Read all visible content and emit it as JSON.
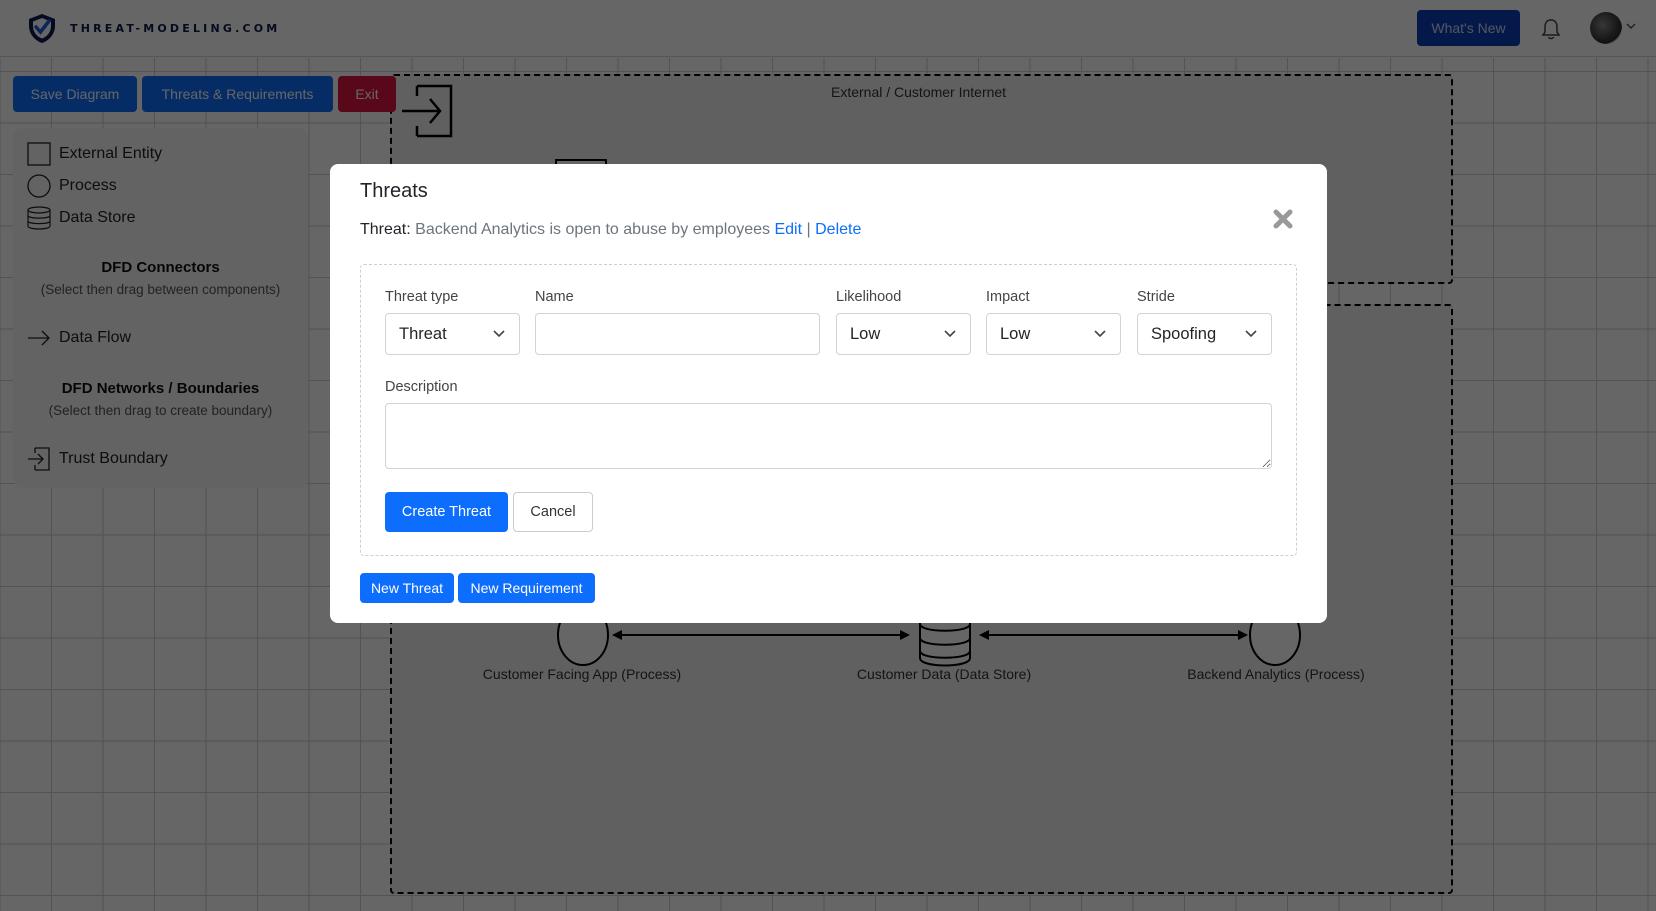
{
  "header": {
    "brand": "THREAT-MODELING.COM",
    "whats_new_label": "What's New",
    "icons": {
      "logo": "shield-check-icon",
      "notifications": "bell-icon",
      "avatar": "user-avatar",
      "menu": "chevron-down-icon"
    }
  },
  "toolbar": {
    "save_label": "Save Diagram",
    "threats_label": "Threats & Requirements",
    "exit_label": "Exit"
  },
  "palette": {
    "components": [
      {
        "label": "External Entity",
        "icon": "square-icon"
      },
      {
        "label": "Process",
        "icon": "circle-icon"
      },
      {
        "label": "Data Store",
        "icon": "database-icon"
      }
    ],
    "connectors_heading": "DFD Connectors",
    "connectors_hint": "(Select then drag between components)",
    "connectors": [
      {
        "label": "Data Flow",
        "icon": "arrow-right-icon"
      }
    ],
    "boundaries_heading": "DFD Networks / Boundaries",
    "boundaries_hint": "(Select then drag to create boundary)",
    "boundaries": [
      {
        "label": "Trust Boundary",
        "icon": "boundary-enter-icon"
      }
    ]
  },
  "diagram": {
    "boundaries": [
      {
        "label": "External / Customer Internet"
      }
    ],
    "nodes": [
      {
        "label": "Customer Facing App (Process)",
        "type": "process"
      },
      {
        "label": "Customer Data (Data Store)",
        "type": "datastore"
      },
      {
        "label": "Backend Analytics (Process)",
        "type": "process"
      }
    ],
    "flows": [
      {
        "from": "Customer Facing App (Process)",
        "to": "Customer Data (Data Store)",
        "bidirectional": true
      },
      {
        "from": "Customer Data (Data Store)",
        "to": "Backend Analytics (Process)",
        "bidirectional": true
      }
    ]
  },
  "modal": {
    "title": "Threats",
    "threat_prefix": "Threat:",
    "threat_text": "Backend Analytics is open to abuse by employees",
    "edit_label": "Edit",
    "separator": "|",
    "delete_label": "Delete",
    "form": {
      "threat_type": {
        "label": "Threat type",
        "value": "Threat"
      },
      "name": {
        "label": "Name",
        "value": "",
        "placeholder": ""
      },
      "likelihood": {
        "label": "Likelihood",
        "value": "Low"
      },
      "impact": {
        "label": "Impact",
        "value": "Low"
      },
      "stride": {
        "label": "Stride",
        "value": "Spoofing"
      },
      "description": {
        "label": "Description",
        "value": "",
        "placeholder": ""
      },
      "create_label": "Create Threat",
      "cancel_label": "Cancel"
    },
    "new_threat_label": "New Threat",
    "new_requirement_label": "New Requirement"
  }
}
